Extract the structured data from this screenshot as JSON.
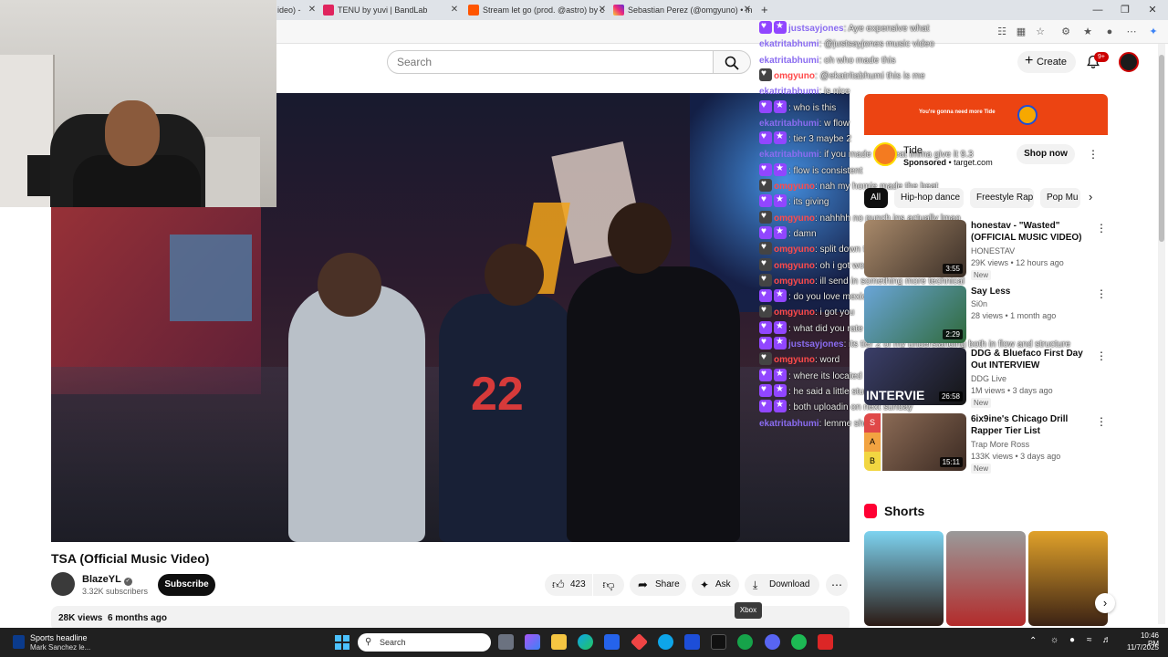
{
  "browser": {
    "tabs": [
      {
        "label": "ideo) -",
        "icon": "youtube-icon"
      },
      {
        "label": "TENU by yuvi | BandLab",
        "icon": "bandlab-icon"
      },
      {
        "label": "Stream let go (prod. @astro) by c",
        "icon": "soundcloud-icon"
      },
      {
        "label": "Sebastian Perez (@omgyuno) • In",
        "icon": "instagram-icon"
      }
    ],
    "new_tab": "+",
    "close": "✕"
  },
  "masthead": {
    "search_placeholder": "Search",
    "create_label": "Create",
    "notif_count": "9+"
  },
  "video": {
    "title": "TSA (Official Music Video)",
    "channel": "BlazeYL",
    "subscribers": "3.32K subscribers",
    "subscribe_label": "Subscribe",
    "likes": "423",
    "share_label": "Share",
    "ask_label": "Ask",
    "download_label": "Download",
    "views": "28K views",
    "age": "6 months ago",
    "tooltip": "Xbox"
  },
  "ad": {
    "banner_text": "You're gonna need more Tide",
    "brand": "Tide",
    "sponsored": "Sponsored",
    "domain": "target.com",
    "cta": "Shop now"
  },
  "chips": [
    "All",
    "Hip-hop dance",
    "Freestyle Rap",
    "Pop Mu"
  ],
  "recommendations": [
    {
      "title": "honestav - \"Wasted\" (OFFICIAL MUSIC VIDEO)",
      "channel": "HONESTAV",
      "meta": "29K views • 12 hours ago",
      "badge": "New",
      "duration": "3:55"
    },
    {
      "title": "Say Less",
      "channel": "Si0n",
      "meta": "28 views • 1 month ago",
      "badge": "",
      "duration": "2:29"
    },
    {
      "title": "DDG & Bluefaco First Day Out INTERVIEW",
      "channel": "DDG Live",
      "meta": "1M views • 3 days ago",
      "badge": "New",
      "duration": "26:58"
    },
    {
      "title": "6ix9ine's Chicago Drill Rapper Tier List",
      "channel": "Trap More Ross",
      "meta": "133K views • 3 days ago",
      "badge": "New",
      "duration": "15:11"
    }
  ],
  "shorts_heading": "Shorts",
  "chat": [
    {
      "user": "justsayjones",
      "color": "purple",
      "badges": 2,
      "msg": ": Aye expensive what"
    },
    {
      "user": "ekatritabhumi",
      "color": "purple",
      "badges": 0,
      "msg": ": @justsayjones music video"
    },
    {
      "user": "ekatritabhumi",
      "color": "purple",
      "badges": 0,
      "msg": ": oh who made this"
    },
    {
      "user": "omgyuno",
      "color": "red",
      "badges": 1,
      "msg": ": @ekatritabhumi this is me"
    },
    {
      "user": "ekatritabhumi",
      "color": "purple",
      "badges": 0,
      "msg": ": is nice"
    },
    {
      "user": "",
      "color": "purple",
      "badges": 2,
      "msg": ": who is this"
    },
    {
      "user": "ekatritabhumi",
      "color": "purple",
      "badges": 0,
      "msg": ": w flow"
    },
    {
      "user": "",
      "color": "purple",
      "badges": 2,
      "msg": ": tier 3 maybe 2"
    },
    {
      "user": "ekatritabhumi",
      "color": "purple",
      "badges": 0,
      "msg": ": if you made the beat imma give it 9.3"
    },
    {
      "user": "",
      "color": "purple",
      "badges": 2,
      "msg": ": flow is consistent"
    },
    {
      "user": "omgyuno",
      "color": "red",
      "badges": 1,
      "msg": ": nah my homie made the beat"
    },
    {
      "user": "",
      "color": "purple",
      "badges": 2,
      "msg": ": its giving"
    },
    {
      "user": "omgyuno",
      "color": "red",
      "badges": 1,
      "msg": ": nahhhh no punch ins actually lmao"
    },
    {
      "user": "",
      "color": "purple",
      "badges": 2,
      "msg": ": damn"
    },
    {
      "user": "omgyuno",
      "color": "red",
      "badges": 1,
      "msg": ": split down the middle"
    },
    {
      "user": "omgyuno",
      "color": "red",
      "badges": 1,
      "msg": ": oh i got word, i trust"
    },
    {
      "user": "omgyuno",
      "color": "red",
      "badges": 1,
      "msg": ": ill send in something more technical"
    },
    {
      "user": "",
      "color": "purple",
      "badges": 2,
      "msg": ": do you love mexican and english"
    },
    {
      "user": "omgyuno",
      "color": "red",
      "badges": 1,
      "msg": ": i got you"
    },
    {
      "user": "",
      "color": "purple",
      "badges": 2,
      "msg": ": what did you rate that last song i was song"
    },
    {
      "user": "justsayjones",
      "color": "purple",
      "badges": 2,
      "msg": ": its tier 2 of my understanding both in flow and structure"
    },
    {
      "user": "omgyuno",
      "color": "red",
      "badges": 1,
      "msg": ": word"
    },
    {
      "user": "",
      "color": "purple",
      "badges": 2,
      "msg": ": where its located"
    },
    {
      "user": "",
      "color": "purple",
      "badges": 2,
      "msg": ": he said a little studio"
    },
    {
      "user": "",
      "color": "purple",
      "badges": 2,
      "msg": ": both uploadin on next sunday"
    },
    {
      "user": "ekatritabhumi",
      "color": "purple",
      "badges": 0,
      "msg": ": lemme show you other music"
    }
  ],
  "taskbar": {
    "news_title": "Sports headline",
    "news_sub": "Mark Sanchez le...",
    "search_placeholder": "Search",
    "time": "10:46 PM",
    "date": "11/7/2025"
  }
}
